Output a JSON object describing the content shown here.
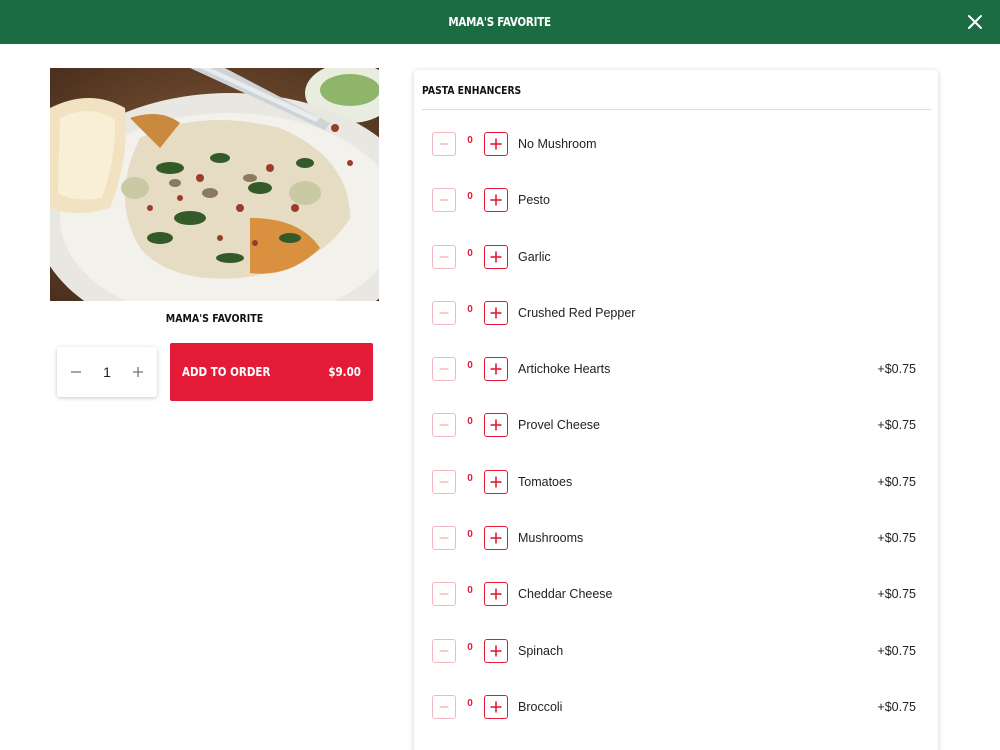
{
  "header": {
    "title": "MAMA'S FAVORITE",
    "close_icon": "close-icon"
  },
  "item": {
    "photo_description_icon": "food-photo",
    "title": "MAMA'S FAVORITE"
  },
  "order": {
    "quantity": "1",
    "add_label": "ADD TO ORDER",
    "price": "$9.00"
  },
  "panel": {
    "title": "PASTA ENHANCERS",
    "options": [
      {
        "count": "0",
        "name": "No Mushroom",
        "price": ""
      },
      {
        "count": "0",
        "name": "Pesto",
        "price": ""
      },
      {
        "count": "0",
        "name": "Garlic",
        "price": ""
      },
      {
        "count": "0",
        "name": "Crushed Red Pepper",
        "price": ""
      },
      {
        "count": "0",
        "name": "Artichoke Hearts",
        "price": "+$0.75"
      },
      {
        "count": "0",
        "name": "Provel Cheese",
        "price": "+$0.75"
      },
      {
        "count": "0",
        "name": "Tomatoes",
        "price": "+$0.75"
      },
      {
        "count": "0",
        "name": "Mushrooms",
        "price": "+$0.75"
      },
      {
        "count": "0",
        "name": "Cheddar Cheese",
        "price": "+$0.75"
      },
      {
        "count": "0",
        "name": "Spinach",
        "price": "+$0.75"
      },
      {
        "count": "0",
        "name": "Broccoli",
        "price": "+$0.75"
      }
    ]
  },
  "colors": {
    "header_green": "#1b6b43",
    "accent_red": "#e31b36"
  }
}
